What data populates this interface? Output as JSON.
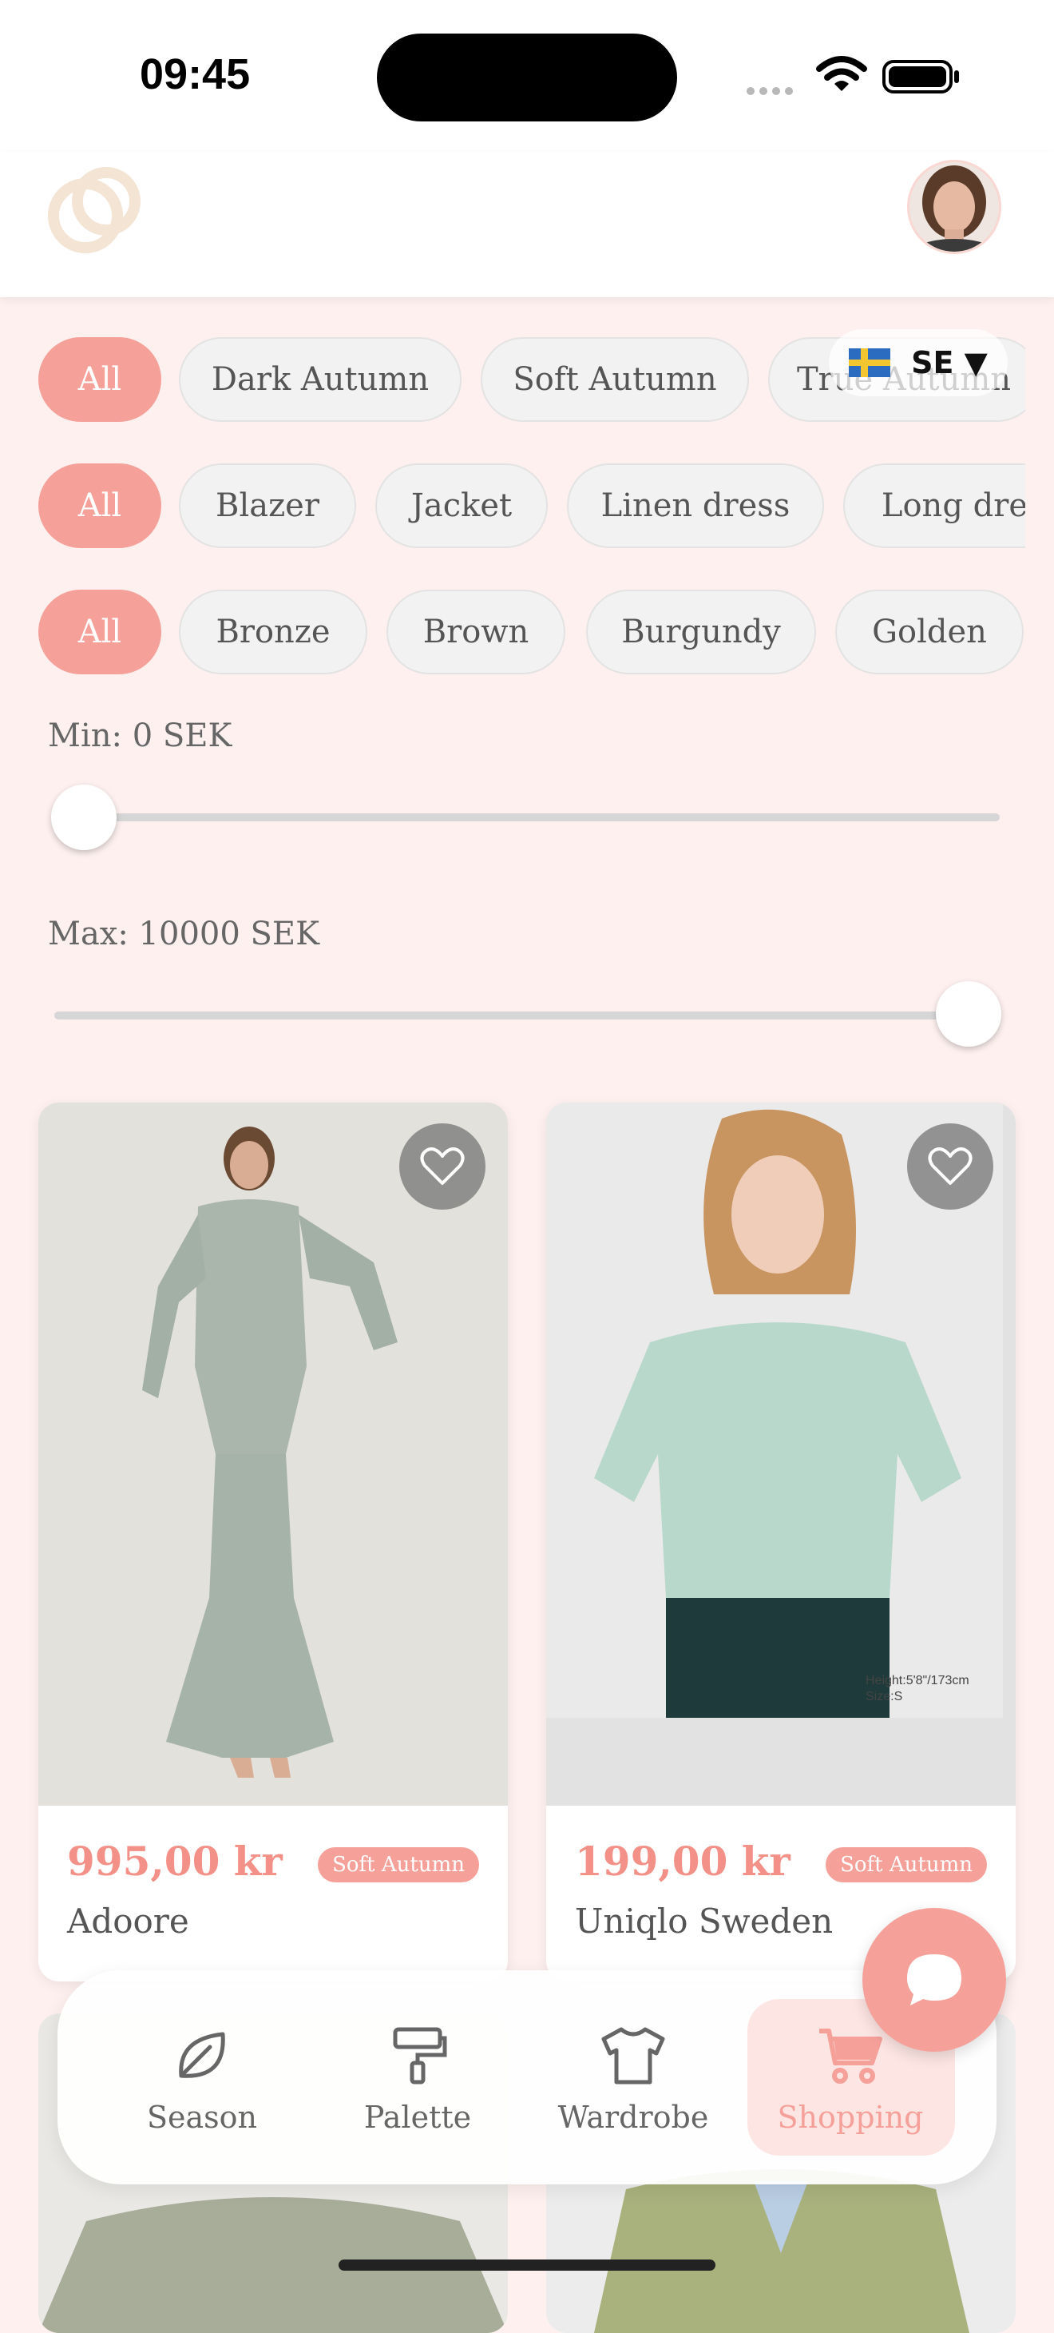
{
  "status": {
    "time": "09:45"
  },
  "header": {
    "language": {
      "code": "SE ▼"
    }
  },
  "filters": {
    "seasons": [
      "All",
      "Dark Autumn",
      "Soft Autumn",
      "True Autumn"
    ],
    "categories": [
      "All",
      "Blazer",
      "Jacket",
      "Linen dress",
      "Long dress"
    ],
    "colors": [
      "All",
      "Bronze",
      "Brown",
      "Burgundy",
      "Golden"
    ]
  },
  "price": {
    "min_label": "Min: 0 SEK",
    "max_label": "Max: 10000 SEK",
    "min_value": 0,
    "max_value": 10000,
    "range": [
      0,
      10000
    ]
  },
  "products": [
    {
      "price": "995,00 kr",
      "brand": "Adoore",
      "season_tag": "Soft Autumn"
    },
    {
      "price": "199,00 kr",
      "brand": "Uniqlo Sweden",
      "season_tag": "Soft Autumn",
      "photo_caption": [
        "Height:5'8\"/173cm",
        "Size:S"
      ]
    }
  ],
  "nav": {
    "items": [
      {
        "label": "Season",
        "icon": "leaf-icon"
      },
      {
        "label": "Palette",
        "icon": "paint-roller-icon"
      },
      {
        "label": "Wardrobe",
        "icon": "tshirt-icon"
      },
      {
        "label": "Shopping",
        "icon": "cart-icon",
        "active": true
      }
    ]
  },
  "colors": {
    "accent": "#f6a09a",
    "background": "#fdf0ef",
    "price": "#f39087"
  }
}
